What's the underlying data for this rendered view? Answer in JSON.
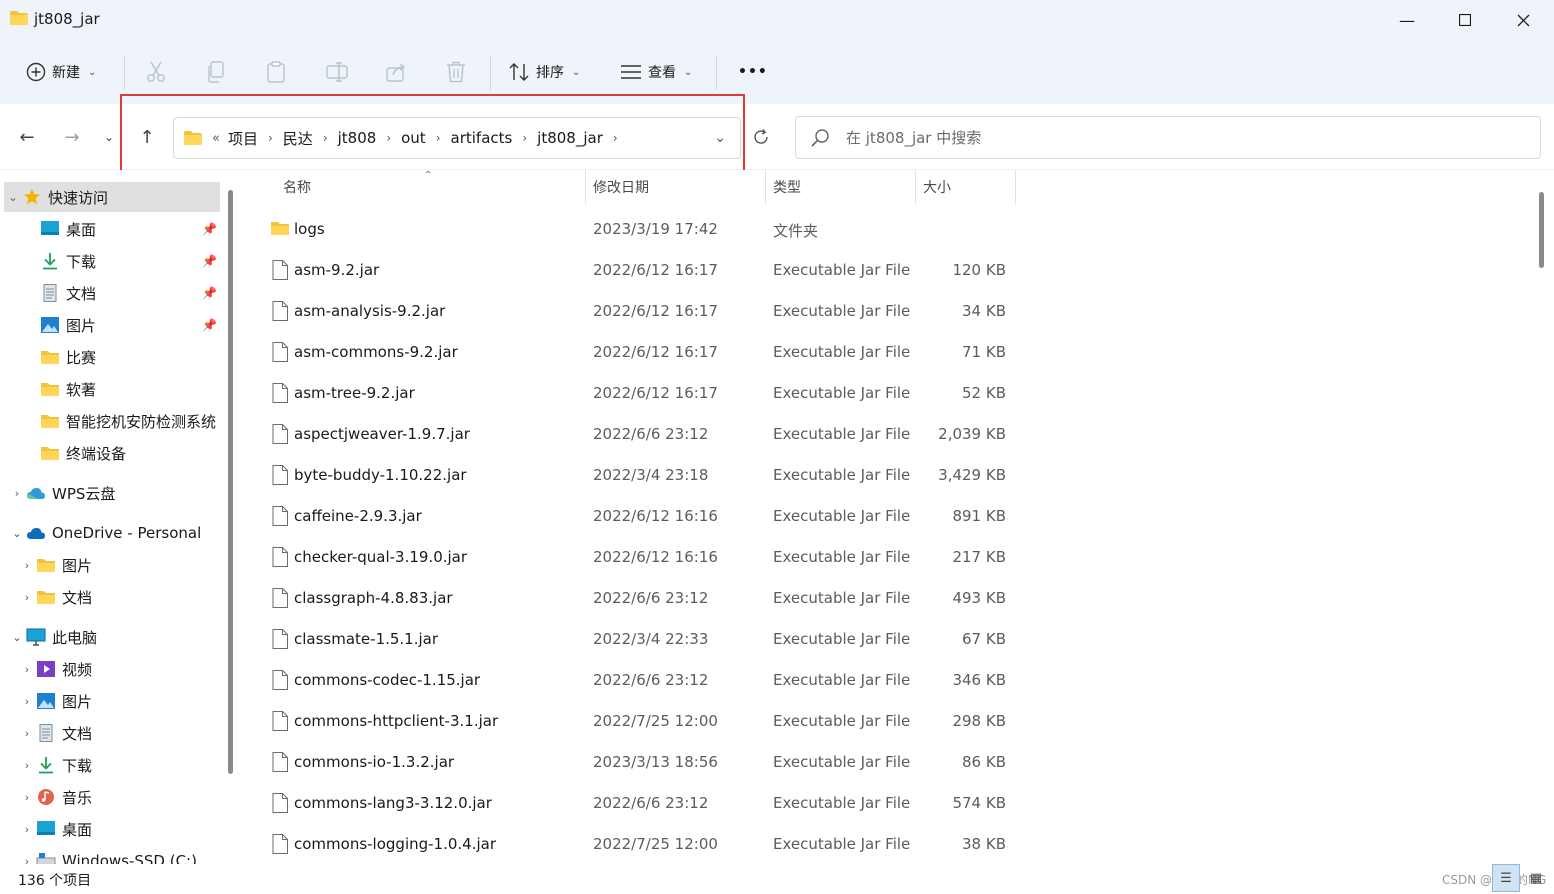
{
  "window": {
    "title": "jt808_jar",
    "minimize_icon": "minimize-icon",
    "maximize_icon": "maximize-icon",
    "close_icon": "close-icon"
  },
  "toolbar": {
    "new_label": "新建",
    "sort_label": "排序",
    "view_label": "查看",
    "more_label": "•••"
  },
  "address": {
    "overflow": "«",
    "crumbs": [
      "项目",
      "民达",
      "jt808",
      "out",
      "artifacts",
      "jt808_jar"
    ],
    "search_placeholder": "在 jt808_jar 中搜索"
  },
  "sidebar": {
    "quick_access": "快速访问",
    "quick_items": [
      {
        "label": "桌面",
        "icon": "desktop-icon",
        "pinned": true
      },
      {
        "label": "下载",
        "icon": "download-icon",
        "pinned": true
      },
      {
        "label": "文档",
        "icon": "document-icon",
        "pinned": true
      },
      {
        "label": "图片",
        "icon": "pictures-icon",
        "pinned": true
      },
      {
        "label": "比赛",
        "icon": "folder-icon",
        "pinned": false
      },
      {
        "label": "软著",
        "icon": "folder-icon",
        "pinned": false
      },
      {
        "label": "智能挖机安防检测系统",
        "icon": "folder-icon",
        "pinned": false
      },
      {
        "label": "终端设备",
        "icon": "folder-icon",
        "pinned": false
      }
    ],
    "wps": "WPS云盘",
    "onedrive": "OneDrive - Personal",
    "onedrive_items": [
      "图片",
      "文档"
    ],
    "this_pc": "此电脑",
    "pc_items": [
      "视频",
      "图片",
      "文档",
      "下载",
      "音乐",
      "桌面",
      "Windows-SSD (C:)"
    ]
  },
  "columns": {
    "name": "名称",
    "date": "修改日期",
    "type": "类型",
    "size": "大小"
  },
  "files": [
    {
      "name": "logs",
      "date": "2023/3/19 17:42",
      "type": "文件夹",
      "size": "",
      "kind": "folder"
    },
    {
      "name": "asm-9.2.jar",
      "date": "2022/6/12 16:17",
      "type": "Executable Jar File",
      "size": "120 KB",
      "kind": "file"
    },
    {
      "name": "asm-analysis-9.2.jar",
      "date": "2022/6/12 16:17",
      "type": "Executable Jar File",
      "size": "34 KB",
      "kind": "file"
    },
    {
      "name": "asm-commons-9.2.jar",
      "date": "2022/6/12 16:17",
      "type": "Executable Jar File",
      "size": "71 KB",
      "kind": "file"
    },
    {
      "name": "asm-tree-9.2.jar",
      "date": "2022/6/12 16:17",
      "type": "Executable Jar File",
      "size": "52 KB",
      "kind": "file"
    },
    {
      "name": "aspectjweaver-1.9.7.jar",
      "date": "2022/6/6 23:12",
      "type": "Executable Jar File",
      "size": "2,039 KB",
      "kind": "file"
    },
    {
      "name": "byte-buddy-1.10.22.jar",
      "date": "2022/3/4 23:18",
      "type": "Executable Jar File",
      "size": "3,429 KB",
      "kind": "file"
    },
    {
      "name": "caffeine-2.9.3.jar",
      "date": "2022/6/12 16:16",
      "type": "Executable Jar File",
      "size": "891 KB",
      "kind": "file"
    },
    {
      "name": "checker-qual-3.19.0.jar",
      "date": "2022/6/12 16:16",
      "type": "Executable Jar File",
      "size": "217 KB",
      "kind": "file"
    },
    {
      "name": "classgraph-4.8.83.jar",
      "date": "2022/6/6 23:12",
      "type": "Executable Jar File",
      "size": "493 KB",
      "kind": "file"
    },
    {
      "name": "classmate-1.5.1.jar",
      "date": "2022/3/4 22:33",
      "type": "Executable Jar File",
      "size": "67 KB",
      "kind": "file"
    },
    {
      "name": "commons-codec-1.15.jar",
      "date": "2022/6/6 23:12",
      "type": "Executable Jar File",
      "size": "346 KB",
      "kind": "file"
    },
    {
      "name": "commons-httpclient-3.1.jar",
      "date": "2022/7/25 12:00",
      "type": "Executable Jar File",
      "size": "298 KB",
      "kind": "file"
    },
    {
      "name": "commons-io-1.3.2.jar",
      "date": "2023/3/13 18:56",
      "type": "Executable Jar File",
      "size": "86 KB",
      "kind": "file"
    },
    {
      "name": "commons-lang3-3.12.0.jar",
      "date": "2022/6/6 23:12",
      "type": "Executable Jar File",
      "size": "574 KB",
      "kind": "file"
    },
    {
      "name": "commons-logging-1.0.4.jar",
      "date": "2022/7/25 12:00",
      "type": "Executable Jar File",
      "size": "38 KB",
      "kind": "file"
    }
  ],
  "status": {
    "count": "136 个项目",
    "watermark": "CSDN @酷酷的NG"
  }
}
